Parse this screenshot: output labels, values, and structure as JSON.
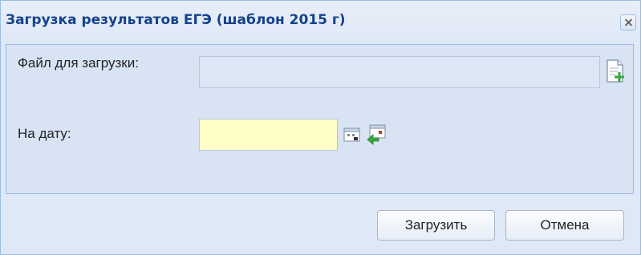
{
  "dialog": {
    "title": "Загрузка результатов ЕГЭ (шаблон 2015 г)"
  },
  "form": {
    "file_label": "Файл для загрузки:",
    "file_value": "",
    "date_label": "На дату:",
    "date_value": ""
  },
  "buttons": {
    "upload_label": "Загрузить",
    "cancel_label": "Отмена"
  },
  "icons": {
    "close": "close-icon",
    "add_file": "add-file-icon",
    "calendar": "calendar-icon",
    "today": "today-icon"
  },
  "colors": {
    "title_text": "#15428b",
    "window_bg": "#dfe8f6",
    "date_field_bg": "#fffdc8",
    "add_accent": "#3aa63a"
  }
}
